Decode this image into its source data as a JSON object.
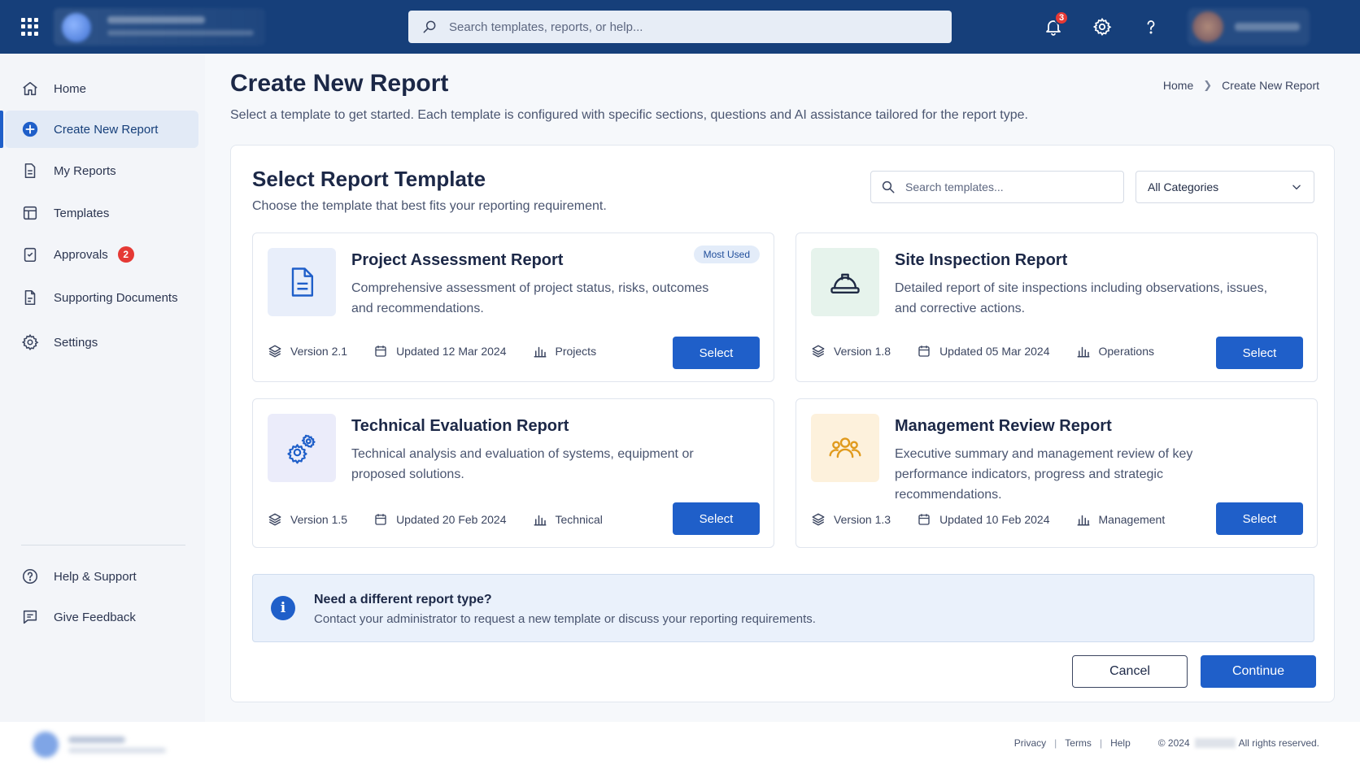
{
  "topbar": {
    "search_placeholder": "Search templates, reports, or help...",
    "notification_count": "3"
  },
  "sidebar": {
    "items": [
      {
        "label": "Home",
        "icon": "home-icon"
      },
      {
        "label": "Create New Report",
        "icon": "plus-circle-icon",
        "active": true
      },
      {
        "label": "My Reports",
        "icon": "document-icon"
      },
      {
        "label": "Templates",
        "icon": "layout-icon"
      },
      {
        "label": "Approvals",
        "icon": "check-document-icon",
        "badge": "2"
      },
      {
        "label": "Supporting Documents",
        "icon": "file-icon"
      },
      {
        "label": "Settings",
        "icon": "gear-icon"
      }
    ],
    "bottom_items": [
      {
        "label": "Help & Support",
        "icon": "question-circle-icon"
      },
      {
        "label": "Give Feedback",
        "icon": "feedback-icon"
      }
    ]
  },
  "page": {
    "title": "Create New Report",
    "subtitle": "Select a template to get started. Each template is configured with specific sections, questions and AI assistance tailored for the report type.",
    "breadcrumb": [
      "Home",
      "Create New Report"
    ]
  },
  "panel": {
    "title": "Select Report Template",
    "subtitle": "Choose the template that best fits your reporting requirement.",
    "search_placeholder": "Search templates...",
    "category_selected": "All Categories",
    "select_label": "Select",
    "cards": [
      {
        "title": "Project Assessment Report",
        "description": "Comprehensive assessment of project status, risks, outcomes and recommendations.",
        "version": "Version 2.1",
        "updated": "Updated 12 Mar 2024",
        "category": "Projects",
        "badge": "Most Used",
        "icon": "document-icon",
        "icon_bg": "#e8eefa",
        "icon_color": "#1f5fc9"
      },
      {
        "title": "Site Inspection Report",
        "description": "Detailed report of site inspections including observations, issues, and corrective actions.",
        "version": "Version 1.8",
        "updated": "Updated 05 Mar 2024",
        "category": "Operations",
        "icon": "hard-hat-icon",
        "icon_bg": "#e6f3ec",
        "icon_color": "#1f2a44"
      },
      {
        "title": "Technical Evaluation Report",
        "description": "Technical analysis and evaluation of systems, equipment or proposed solutions.",
        "version": "Version 1.5",
        "updated": "Updated 20 Feb 2024",
        "category": "Technical",
        "icon": "gears-icon",
        "icon_bg": "#ebecfa",
        "icon_color": "#1f5fc9"
      },
      {
        "title": "Management Review Report",
        "description": "Executive summary and management review of key performance indicators, progress and strategic recommendations.",
        "version": "Version 1.3",
        "updated": "Updated 10 Feb 2024",
        "category": "Management",
        "icon": "users-icon",
        "icon_bg": "#fdf1dc",
        "icon_color": "#e09a1c"
      }
    ],
    "info": {
      "heading": "Need a different report type?",
      "text": "Contact your administrator to request a new template or discuss your reporting requirements."
    },
    "cancel_label": "Cancel",
    "continue_label": "Continue"
  },
  "footer": {
    "links": [
      "Privacy",
      "Terms",
      "Help"
    ],
    "copyright_prefix": "© 2024",
    "rights": "All rights reserved."
  },
  "colors": {
    "primary": "#1f5fc9",
    "topbar": "#163f7a",
    "badge": "#e53935"
  }
}
